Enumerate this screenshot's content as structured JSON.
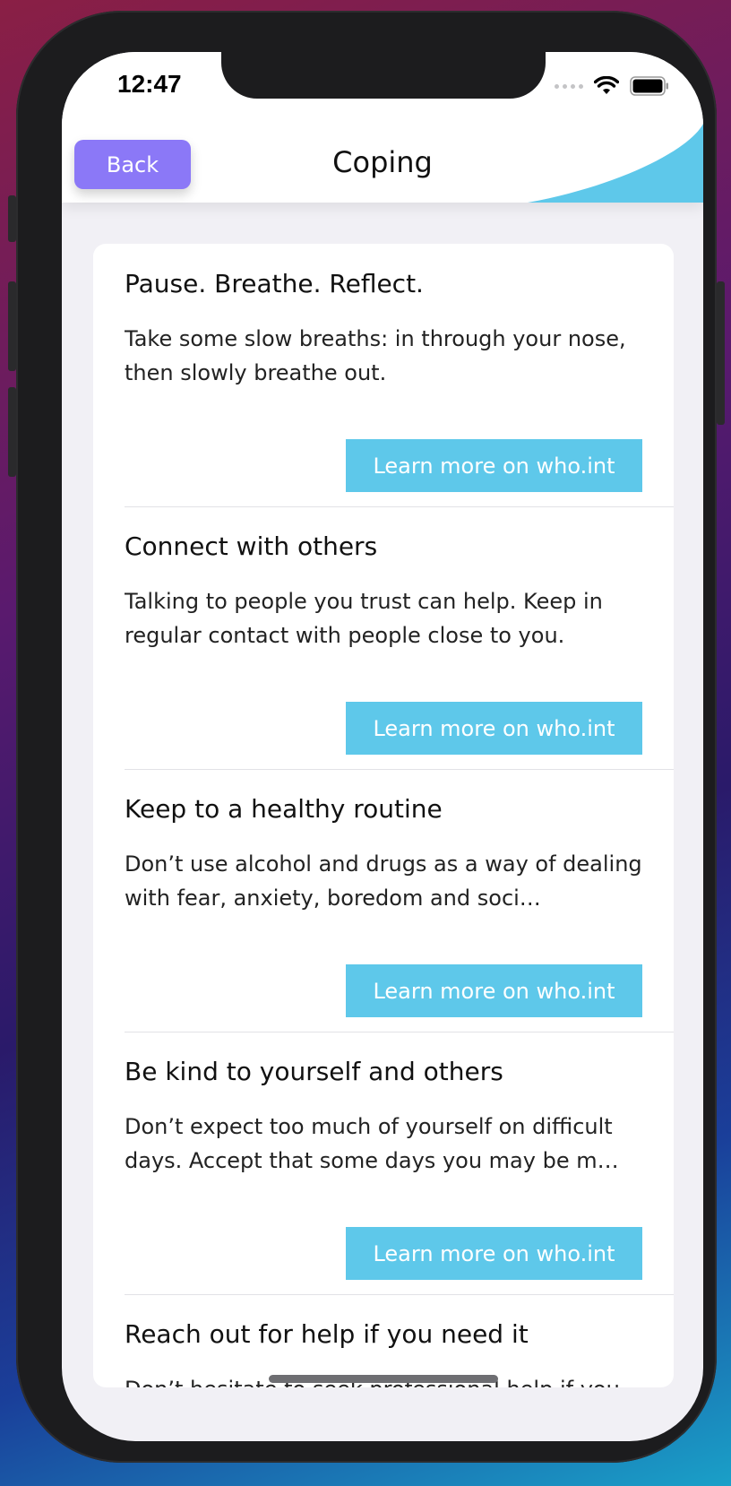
{
  "status_bar": {
    "time": "12:47"
  },
  "header": {
    "back_label": "Back",
    "title": "Coping",
    "accent_color": "#5ec8ea"
  },
  "items": [
    {
      "title": "Pause. Breathe. Reflect.",
      "text": "Take some slow breaths: in through your nose, then slowly breathe out.",
      "button": "Learn more on who.int"
    },
    {
      "title": "Connect with others",
      "text": "Talking to people you trust can help. Keep in regular contact with people close to you.",
      "button": "Learn more on who.int"
    },
    {
      "title": "Keep to a healthy routine",
      "text": "Don’t use alcohol and drugs as a way of dealing with fear, anxiety, boredom and soci…",
      "button": "Learn more on who.int"
    },
    {
      "title": "Be kind to yourself and others",
      "text": "Don’t expect too much of yourself on difficult days. Accept that some days you may be m…",
      "button": "Learn more on who.int"
    },
    {
      "title": "Reach out for help if you need it",
      "text": "Don’t hesitate to seek professional help if you",
      "button": ""
    }
  ],
  "colors": {
    "back_button": "#8b78f7",
    "learn_button": "#5ec8ea",
    "background": "#f1f0f5"
  }
}
